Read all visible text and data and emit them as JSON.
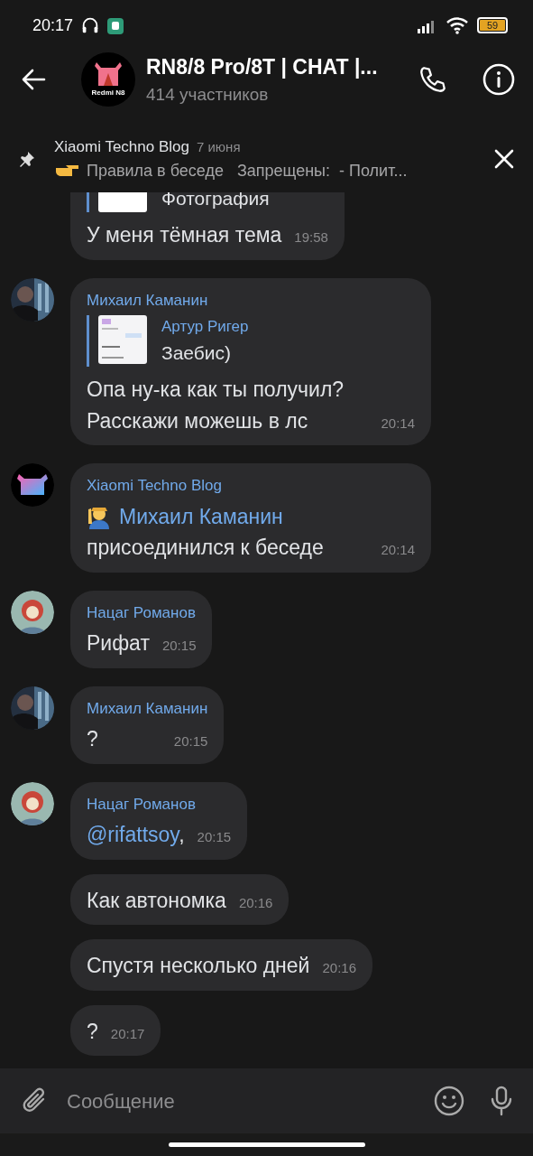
{
  "status_bar": {
    "time": "20:17",
    "battery": "59"
  },
  "header": {
    "title": "RN8/8 Pro/8T | CHAT |...",
    "subtitle": "414 участников",
    "avatar_label": "Redmi N8"
  },
  "pinned": {
    "author": "Xiaomi Techno Blog",
    "date": "7 июня",
    "text": "Правила в беседе   Запрещены:  - Полит..."
  },
  "messages": [
    {
      "kind": "text",
      "reply": {
        "text": "Фотография"
      },
      "text": "У меня тёмная тема",
      "time": "19:58"
    },
    {
      "kind": "text",
      "sender": "Михаил Каманин",
      "reply": {
        "thumb": {
          "kind": "screenshot"
        },
        "author": "Артур Ригер",
        "text": "Заебис)"
      },
      "text": "Опа ну-ка как ты получил?\nРасскажи можешь в лс",
      "time": "20:14"
    },
    {
      "kind": "join",
      "avatar": {
        "kind": "logo"
      },
      "sender": "Xiaomi Techno Blog",
      "member": "Михаил Каманин",
      "text": "присоединился к беседе",
      "time": "20:14"
    },
    {
      "kind": "text",
      "avatar": {
        "kind": "cartoon"
      },
      "sender": "Нацаг Романов",
      "text": "Рифат",
      "time": "20:15"
    },
    {
      "kind": "text",
      "sender": "Михаил Каманин",
      "text": "?",
      "time": "20:15"
    },
    {
      "kind": "text",
      "avatar": {
        "kind": "cartoon"
      },
      "sender": "Нацаг Романов",
      "mention": "@rifattsoy",
      "text": ",",
      "time": "20:15"
    },
    {
      "kind": "text",
      "text": "Как автономка",
      "time": "20:16"
    },
    {
      "kind": "text",
      "text": "Спустя несколько дней",
      "time": "20:16"
    },
    {
      "kind": "text",
      "text": "?",
      "time": "20:17"
    }
  ],
  "composer": {
    "placeholder": "Сообщение"
  }
}
